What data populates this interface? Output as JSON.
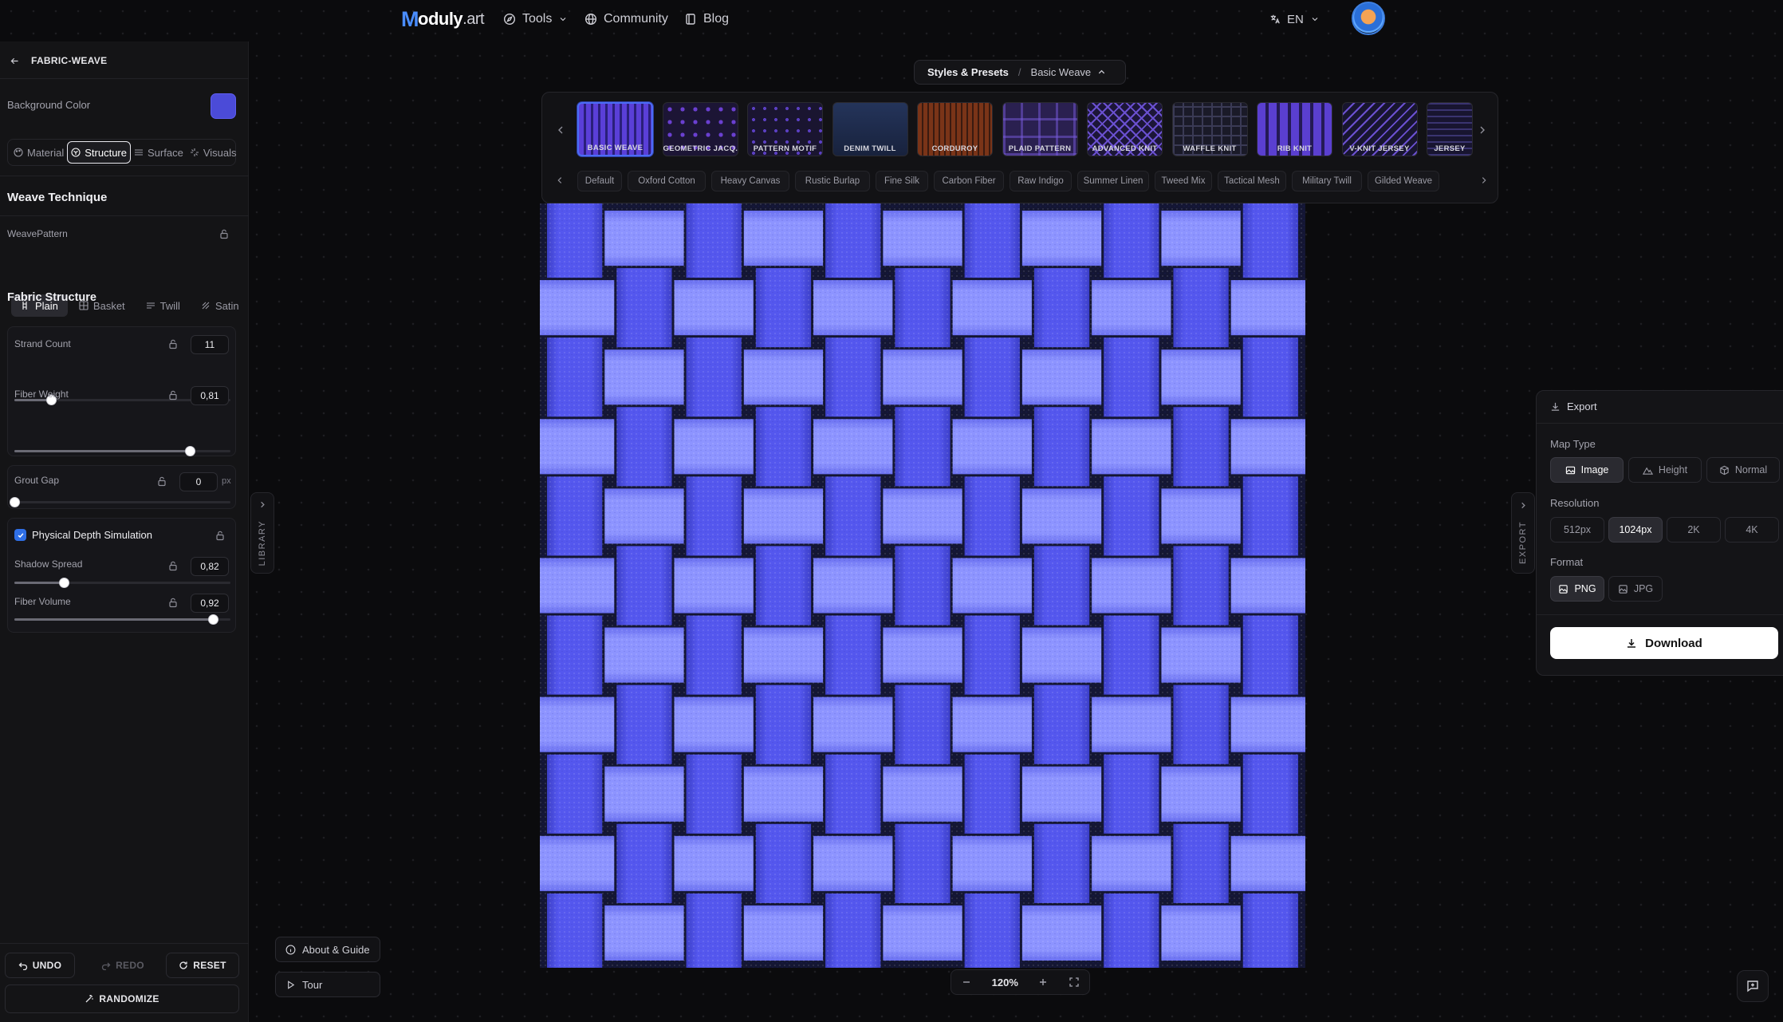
{
  "nav": {
    "logo_m": "M",
    "logo_name": "oduly",
    "logo_tld": ".art",
    "tools": "Tools",
    "community": "Community",
    "blog": "Blog",
    "lang": "EN"
  },
  "left": {
    "back_title": "FABRIC-WEAVE",
    "bg_color_label": "Background Color",
    "bg_color": "#4b4bd8",
    "tabs": [
      "Material",
      "Structure",
      "Surface",
      "Visuals"
    ],
    "active_tab": "Structure",
    "weave_technique": "Weave Technique",
    "weave_pattern_label": "WeavePattern",
    "patterns": [
      "Plain",
      "Basket",
      "Twill",
      "Satin"
    ],
    "active_pattern": "Plain",
    "fabric_structure": "Fabric Structure",
    "strand_count": {
      "label": "Strand Count",
      "value": "11",
      "fraction": 0.17
    },
    "fiber_weight": {
      "label": "Fiber Weight",
      "value": "0,81",
      "fraction": 0.81
    },
    "grout_gap": {
      "label": "Grout Gap",
      "value": "0",
      "unit": "px",
      "fraction": 0.0
    },
    "depth_sim": {
      "label": "Physical Depth Simulation",
      "checked": true
    },
    "shadow_spread": {
      "label": "Shadow Spread",
      "value": "0,82",
      "fraction": 0.23
    },
    "fiber_volume": {
      "label": "Fiber Volume",
      "value": "0,92",
      "fraction": 0.92
    },
    "undo": "UNDO",
    "redo": "REDO",
    "reset": "RESET",
    "randomize": "RANDOMIZE"
  },
  "library_label": "LIBRARY",
  "export_label": "EXPORT",
  "about": "About & Guide",
  "tour": "Tour",
  "styles": {
    "crumb_a": "Styles & Presets",
    "crumb_sep": "/",
    "crumb_b": "Basic Weave",
    "thumbs": [
      "BASIC WEAVE",
      "GEOMETRIC JACQ...",
      "PATTERN MOTIF",
      "DENIM TWILL",
      "CORDUROY",
      "PLAID PATTERN",
      "ADVANCED KNIT",
      "WAFFLE KNIT",
      "RIB KNIT",
      "V-KNIT JERSEY",
      "JERSEY"
    ],
    "active_thumb": "BASIC WEAVE",
    "presets": [
      "Default",
      "Oxford Cotton",
      "Heavy Canvas",
      "Rustic Burlap",
      "Fine Silk",
      "Carbon Fiber",
      "Raw Indigo",
      "Summer Linen",
      "Tweed Mix",
      "Tactical Mesh",
      "Military Twill",
      "Gilded Weave"
    ]
  },
  "zoom": "120%",
  "export": {
    "title": "Export",
    "map_type_label": "Map Type",
    "map_types": [
      "Image",
      "Height",
      "Normal"
    ],
    "active_map": "Image",
    "resolution_label": "Resolution",
    "resolutions": [
      "512px",
      "1024px",
      "2K",
      "4K"
    ],
    "active_res": "1024px",
    "format_label": "Format",
    "formats": [
      "PNG",
      "JPG"
    ],
    "active_format": "PNG",
    "download": "Download"
  },
  "colors": {
    "weave_light": "#8d94ff",
    "weave_dark": "#5457ee",
    "weave_gap": "#141633",
    "accent": "#2f6fe6"
  }
}
